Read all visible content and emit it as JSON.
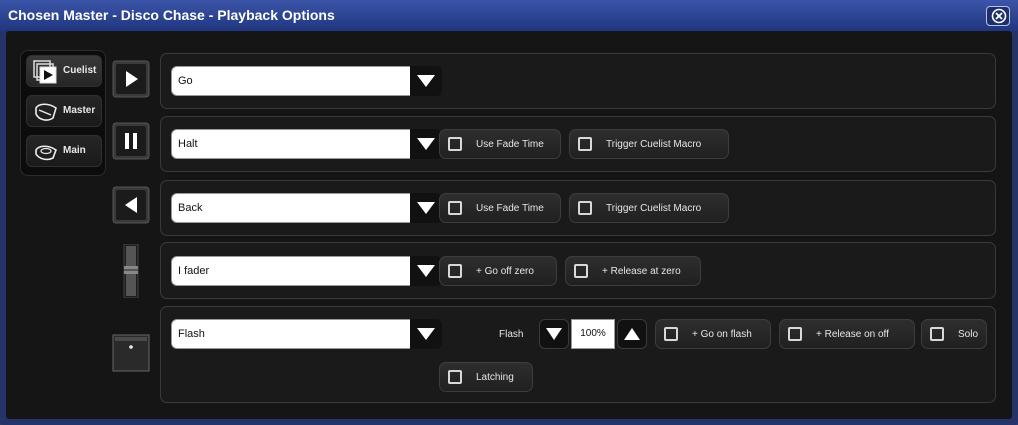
{
  "window": {
    "title": "Chosen Master - Disco Chase - Playback Options"
  },
  "modes": [
    {
      "label": "Cuelist",
      "icon": "cuelist-icon"
    },
    {
      "label": "Master",
      "icon": "master-icon"
    },
    {
      "label": "Main",
      "icon": "main-icon"
    }
  ],
  "rows": {
    "go": {
      "dropdown": "Go",
      "icon": "play-icon"
    },
    "halt": {
      "dropdown": "Halt",
      "icon": "pause-icon",
      "use_fade_time": "Use Fade Time",
      "trigger_macro": "Trigger Cuelist Macro"
    },
    "back": {
      "dropdown": "Back",
      "icon": "back-icon",
      "use_fade_time": "Use Fade Time",
      "trigger_macro": "Trigger Cuelist Macro"
    },
    "fader": {
      "dropdown": "I fader",
      "icon": "fader-icon",
      "go_off_zero": "+ Go off zero",
      "release_at_zero": "+ Release at zero"
    },
    "flash": {
      "dropdown": "Flash",
      "icon": "flash-button-icon",
      "flash_label": "Flash",
      "flash_value": "100%",
      "go_on_flash": "+ Go on flash",
      "release_on_off": "+ Release on off",
      "solo": "Solo",
      "latching": "Latching"
    }
  }
}
